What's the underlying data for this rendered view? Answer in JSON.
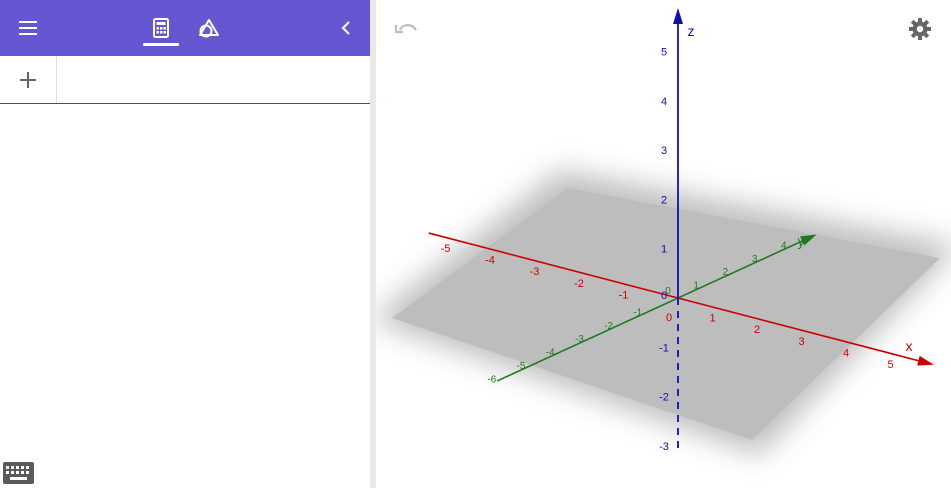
{
  "colors": {
    "toolbar": "#6557d2",
    "x_axis": "#cc0000",
    "y_axis": "#1f7a1f",
    "z_axis": "#1010b0",
    "plane": "#bcbcbc"
  },
  "toolbar": {
    "menu_icon": "hamburger-icon",
    "tabs": [
      {
        "name": "algebra",
        "icon": "calculator-icon",
        "selected": true
      },
      {
        "name": "tools",
        "icon": "shapes-icon",
        "selected": false
      }
    ],
    "collapse_icon": "chevron-left-icon"
  },
  "algebra_input": {
    "add_icon": "plus-icon",
    "value": ""
  },
  "keyboard_icon": "keyboard-icon",
  "graphics": {
    "undo_icon": "undo-icon",
    "settings_icon": "gear-icon",
    "axes": {
      "x": {
        "label": "x",
        "ticks": [
          "-5",
          "-4",
          "-3",
          "-2",
          "-1",
          "0",
          "1",
          "2",
          "3",
          "4",
          "5"
        ]
      },
      "y": {
        "label": "y",
        "ticks": [
          "-6",
          "-5",
          "-4",
          "-3",
          "-2",
          "-1",
          "0",
          "1",
          "2",
          "3",
          "4"
        ]
      },
      "z": {
        "label": "z",
        "ticks": [
          "-3",
          "-2",
          "-1",
          "0",
          "1",
          "2",
          "3",
          "4",
          "5"
        ]
      }
    }
  }
}
